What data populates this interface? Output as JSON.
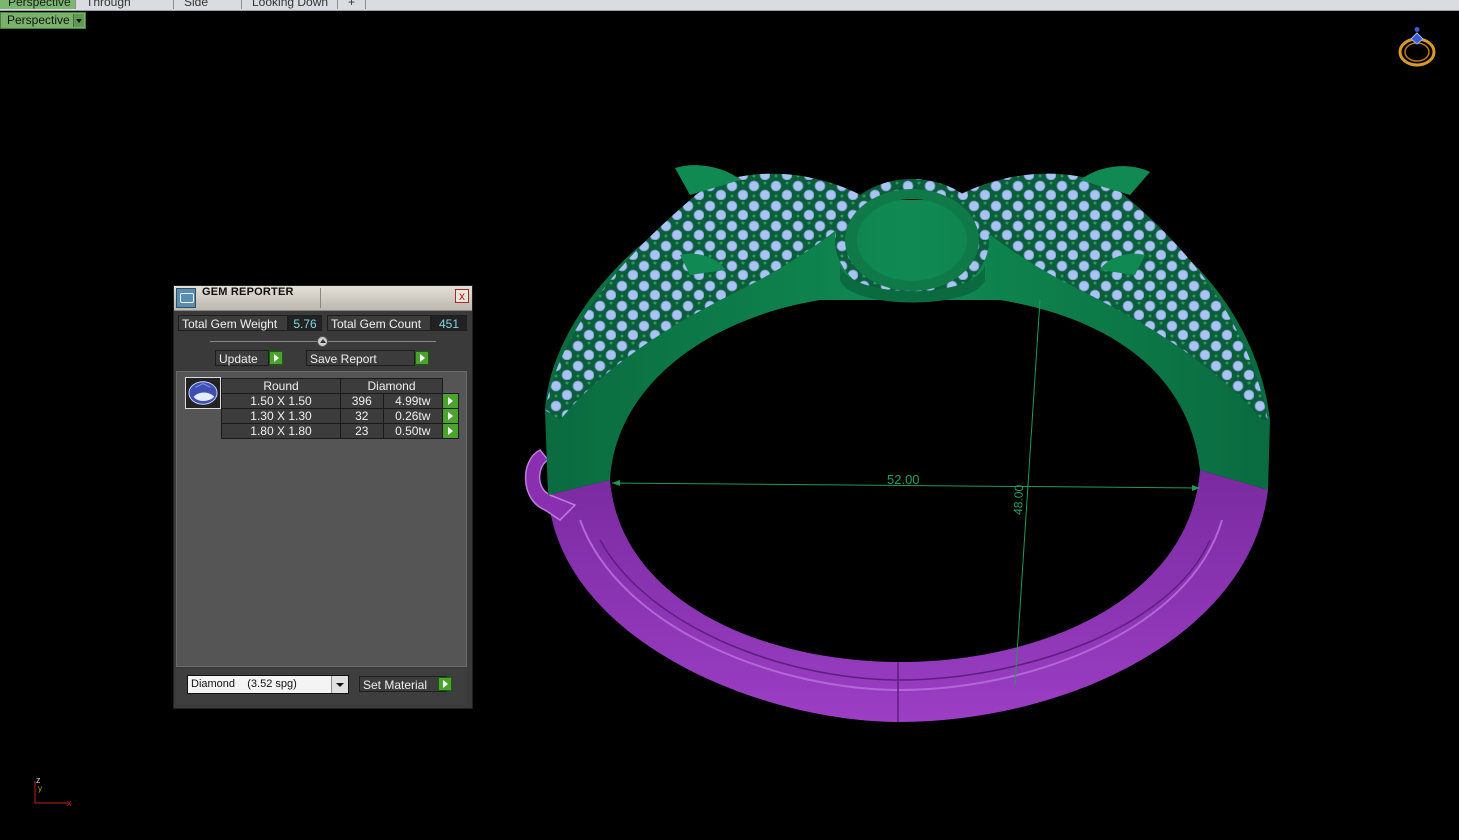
{
  "tabs": [
    {
      "label": "Perspective",
      "active": true
    },
    {
      "label": "Through Finger",
      "active": false
    },
    {
      "label": "Side View",
      "active": false
    },
    {
      "label": "Looking Down",
      "active": false
    },
    {
      "label": "+",
      "active": false
    }
  ],
  "viewport": {
    "label": "Perspective"
  },
  "model": {
    "width_dimension": "52.00",
    "height_dimension": "48.00",
    "colors": {
      "head": "#0e7a4a",
      "shank": "#8a2fb0",
      "gems": "#a9c4f0"
    }
  },
  "axis": {
    "z": "z",
    "x": "x",
    "y": "y"
  },
  "gem_reporter": {
    "title": "GEM REPORTER",
    "close_label": "x",
    "total_weight_label": "Total Gem Weight",
    "total_weight_value": "5.76",
    "total_count_label": "Total Gem Count",
    "total_count_value": "451",
    "update_label": "Update",
    "save_report_label": "Save Report",
    "table_headers": {
      "shape": "Round",
      "material": "Diamond"
    },
    "rows": [
      {
        "size": "1.50 X 1.50",
        "count": "396",
        "weight": "4.99tw"
      },
      {
        "size": "1.30 X 1.30",
        "count": "32",
        "weight": "0.26tw"
      },
      {
        "size": "1.80 X 1.80",
        "count": "23",
        "weight": "0.50tw"
      }
    ],
    "material_select": "Diamond    (3.52 spg)",
    "set_material_label": "Set Material"
  }
}
